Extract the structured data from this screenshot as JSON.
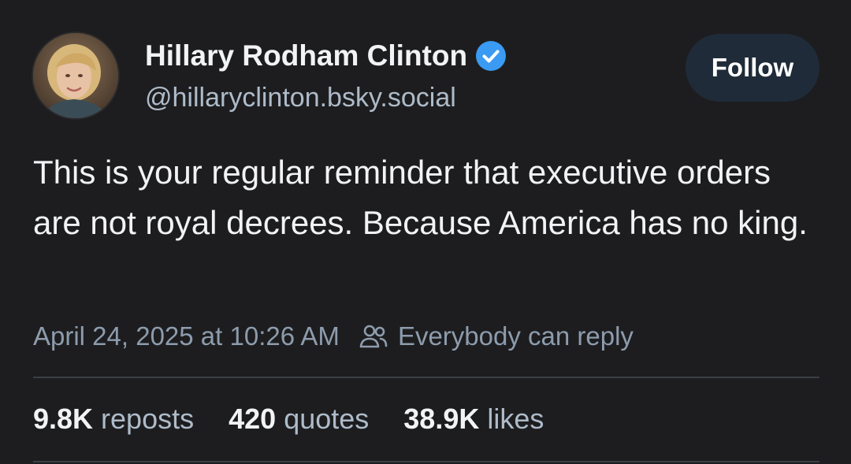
{
  "author": {
    "display_name": "Hillary Rodham Clinton",
    "handle": "@hillaryclinton.bsky.social",
    "verified": true,
    "verified_color": "#3b9af2"
  },
  "follow_button": {
    "label": "Follow"
  },
  "post": {
    "text": "This is your regular reminder that executive orders are not royal decrees. Because America has no king.",
    "timestamp": "April 24, 2025 at 10:26 AM",
    "reply_setting": "Everybody can reply"
  },
  "stats": {
    "reposts": {
      "count": "9.8K",
      "label": "reposts"
    },
    "quotes": {
      "count": "420",
      "label": "quotes"
    },
    "likes": {
      "count": "38.9K",
      "label": "likes"
    }
  },
  "colors": {
    "background": "#1d1d1f",
    "primary_text": "#f1f3f5",
    "secondary_text": "#aebbc9",
    "meta_text": "#8d9cad",
    "follow_button_bg": "#1f2b38"
  },
  "icons": {
    "verified": "verified-check-icon",
    "reply_setting": "people-icon"
  }
}
